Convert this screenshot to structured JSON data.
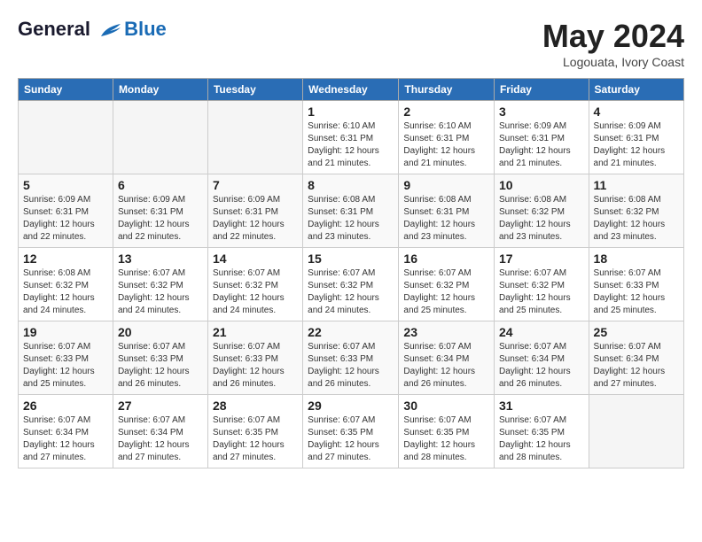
{
  "header": {
    "logo_line1": "General",
    "logo_line2": "Blue",
    "month": "May 2024",
    "location": "Logouata, Ivory Coast"
  },
  "weekdays": [
    "Sunday",
    "Monday",
    "Tuesday",
    "Wednesday",
    "Thursday",
    "Friday",
    "Saturday"
  ],
  "weeks": [
    [
      {
        "day": "",
        "info": ""
      },
      {
        "day": "",
        "info": ""
      },
      {
        "day": "",
        "info": ""
      },
      {
        "day": "1",
        "info": "Sunrise: 6:10 AM\nSunset: 6:31 PM\nDaylight: 12 hours\nand 21 minutes."
      },
      {
        "day": "2",
        "info": "Sunrise: 6:10 AM\nSunset: 6:31 PM\nDaylight: 12 hours\nand 21 minutes."
      },
      {
        "day": "3",
        "info": "Sunrise: 6:09 AM\nSunset: 6:31 PM\nDaylight: 12 hours\nand 21 minutes."
      },
      {
        "day": "4",
        "info": "Sunrise: 6:09 AM\nSunset: 6:31 PM\nDaylight: 12 hours\nand 21 minutes."
      }
    ],
    [
      {
        "day": "5",
        "info": "Sunrise: 6:09 AM\nSunset: 6:31 PM\nDaylight: 12 hours\nand 22 minutes."
      },
      {
        "day": "6",
        "info": "Sunrise: 6:09 AM\nSunset: 6:31 PM\nDaylight: 12 hours\nand 22 minutes."
      },
      {
        "day": "7",
        "info": "Sunrise: 6:09 AM\nSunset: 6:31 PM\nDaylight: 12 hours\nand 22 minutes."
      },
      {
        "day": "8",
        "info": "Sunrise: 6:08 AM\nSunset: 6:31 PM\nDaylight: 12 hours\nand 23 minutes."
      },
      {
        "day": "9",
        "info": "Sunrise: 6:08 AM\nSunset: 6:31 PM\nDaylight: 12 hours\nand 23 minutes."
      },
      {
        "day": "10",
        "info": "Sunrise: 6:08 AM\nSunset: 6:32 PM\nDaylight: 12 hours\nand 23 minutes."
      },
      {
        "day": "11",
        "info": "Sunrise: 6:08 AM\nSunset: 6:32 PM\nDaylight: 12 hours\nand 23 minutes."
      }
    ],
    [
      {
        "day": "12",
        "info": "Sunrise: 6:08 AM\nSunset: 6:32 PM\nDaylight: 12 hours\nand 24 minutes."
      },
      {
        "day": "13",
        "info": "Sunrise: 6:07 AM\nSunset: 6:32 PM\nDaylight: 12 hours\nand 24 minutes."
      },
      {
        "day": "14",
        "info": "Sunrise: 6:07 AM\nSunset: 6:32 PM\nDaylight: 12 hours\nand 24 minutes."
      },
      {
        "day": "15",
        "info": "Sunrise: 6:07 AM\nSunset: 6:32 PM\nDaylight: 12 hours\nand 24 minutes."
      },
      {
        "day": "16",
        "info": "Sunrise: 6:07 AM\nSunset: 6:32 PM\nDaylight: 12 hours\nand 25 minutes."
      },
      {
        "day": "17",
        "info": "Sunrise: 6:07 AM\nSunset: 6:32 PM\nDaylight: 12 hours\nand 25 minutes."
      },
      {
        "day": "18",
        "info": "Sunrise: 6:07 AM\nSunset: 6:33 PM\nDaylight: 12 hours\nand 25 minutes."
      }
    ],
    [
      {
        "day": "19",
        "info": "Sunrise: 6:07 AM\nSunset: 6:33 PM\nDaylight: 12 hours\nand 25 minutes."
      },
      {
        "day": "20",
        "info": "Sunrise: 6:07 AM\nSunset: 6:33 PM\nDaylight: 12 hours\nand 26 minutes."
      },
      {
        "day": "21",
        "info": "Sunrise: 6:07 AM\nSunset: 6:33 PM\nDaylight: 12 hours\nand 26 minutes."
      },
      {
        "day": "22",
        "info": "Sunrise: 6:07 AM\nSunset: 6:33 PM\nDaylight: 12 hours\nand 26 minutes."
      },
      {
        "day": "23",
        "info": "Sunrise: 6:07 AM\nSunset: 6:34 PM\nDaylight: 12 hours\nand 26 minutes."
      },
      {
        "day": "24",
        "info": "Sunrise: 6:07 AM\nSunset: 6:34 PM\nDaylight: 12 hours\nand 26 minutes."
      },
      {
        "day": "25",
        "info": "Sunrise: 6:07 AM\nSunset: 6:34 PM\nDaylight: 12 hours\nand 27 minutes."
      }
    ],
    [
      {
        "day": "26",
        "info": "Sunrise: 6:07 AM\nSunset: 6:34 PM\nDaylight: 12 hours\nand 27 minutes."
      },
      {
        "day": "27",
        "info": "Sunrise: 6:07 AM\nSunset: 6:34 PM\nDaylight: 12 hours\nand 27 minutes."
      },
      {
        "day": "28",
        "info": "Sunrise: 6:07 AM\nSunset: 6:35 PM\nDaylight: 12 hours\nand 27 minutes."
      },
      {
        "day": "29",
        "info": "Sunrise: 6:07 AM\nSunset: 6:35 PM\nDaylight: 12 hours\nand 27 minutes."
      },
      {
        "day": "30",
        "info": "Sunrise: 6:07 AM\nSunset: 6:35 PM\nDaylight: 12 hours\nand 28 minutes."
      },
      {
        "day": "31",
        "info": "Sunrise: 6:07 AM\nSunset: 6:35 PM\nDaylight: 12 hours\nand 28 minutes."
      },
      {
        "day": "",
        "info": ""
      }
    ]
  ]
}
